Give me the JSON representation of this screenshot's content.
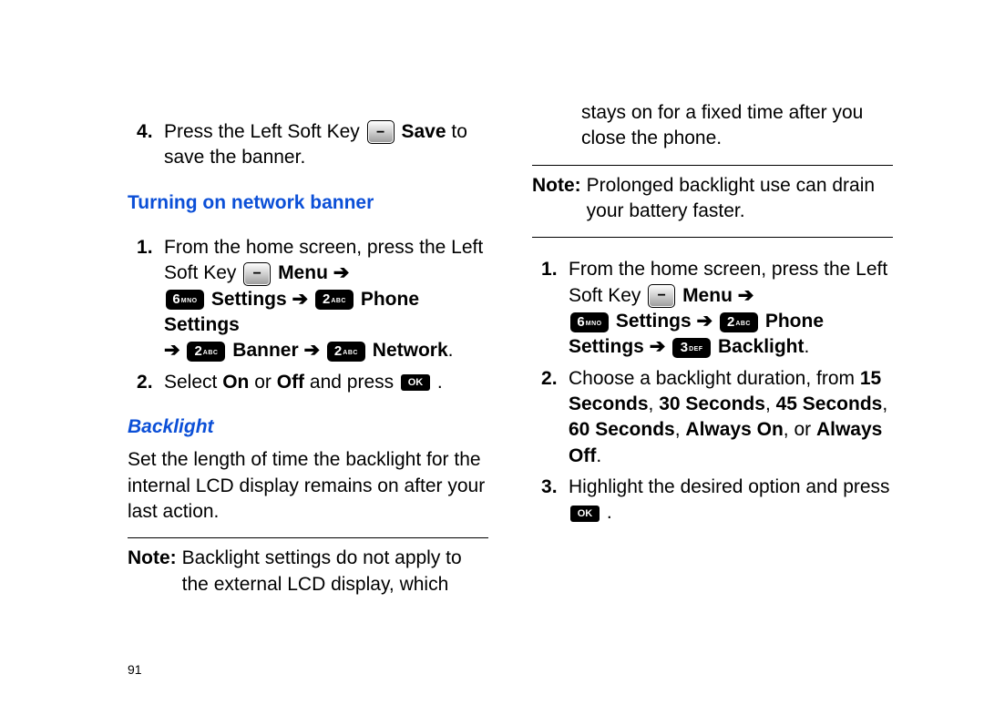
{
  "left": {
    "step4_a": "Press the Left Soft Key ",
    "step4_b": " Save",
    "step4_c": " to save the banner.",
    "heading_network": "Turning on network banner",
    "net_step1_a": "From the home screen, press the Left Soft Key ",
    "net_menu": " Menu ",
    "net_settings": " Settings ",
    "net_phone_settings": " Phone Settings ",
    "net_banner": " Banner ",
    "net_network": " Network",
    "net_step2_a": "Select ",
    "net_on": "On",
    "net_or": " or ",
    "net_off": "Off",
    "net_step2_b": " and press ",
    "heading_backlight": "Backlight",
    "backlight_para": "Set the length of time the backlight for the internal LCD display remains on after your last action.",
    "note_label": "Note:",
    "note_body": "Backlight settings do not apply to the external LCD display, which",
    "pagenum": "91"
  },
  "right": {
    "cont": "stays on for a fixed time after you close the phone.",
    "note_label": "Note:",
    "note_body": "Prolonged backlight use can drain your battery faster.",
    "step1_a": "From the home screen, press the Left Soft Key ",
    "menu": " Menu ",
    "settings": " Settings ",
    "phone": " Phone Settings ",
    "backlight": " Backlight",
    "step2_a": "Choose a backlight duration, from ",
    "d15": "15 Seconds",
    "c1": ", ",
    "d30": "30 Seconds",
    "c2": ", ",
    "d45": "45 Seconds",
    "c3": ", ",
    "d60": "60 Seconds",
    "c4": ", ",
    "aon": "Always On",
    "c5": ", or ",
    "aoff": "Always Off",
    "step3_a": "Highlight the desired option and press "
  },
  "icons": {
    "arrow": "➔",
    "ok": "OK",
    "period": "."
  },
  "keys": {
    "six_big": "6",
    "six_sub": "MNO",
    "two_big": "2",
    "two_sub": "ABC",
    "three_big": "3",
    "three_sub": "DEF"
  }
}
